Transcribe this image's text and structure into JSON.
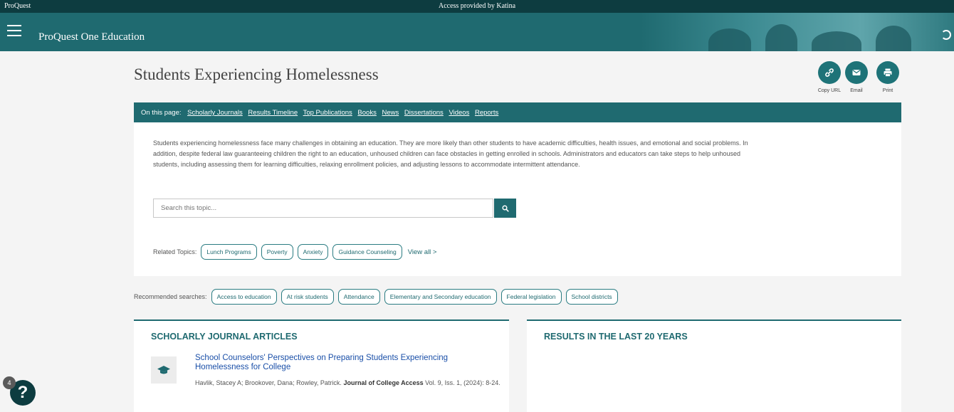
{
  "topbar": {
    "brand": "ProQuest",
    "access": "Access provided by Katina"
  },
  "header": {
    "title": "ProQuest One Education"
  },
  "page": {
    "title": "Students Experiencing Homelessness"
  },
  "actions": [
    {
      "label": "Copy URL",
      "icon": "link-icon"
    },
    {
      "label": "Email",
      "icon": "email-icon"
    },
    {
      "label": "Print",
      "icon": "print-icon"
    }
  ],
  "nav": {
    "on_this_page": "On this page:",
    "links": [
      "Scholarly Journals",
      "Results Timeline",
      "Top Publications",
      "Books",
      "News",
      "Dissertations",
      "Videos",
      "Reports"
    ]
  },
  "description": "Students experiencing homelessness face many challenges in obtaining an education. They are more likely than other students to have academic difficulties, health issues, and emotional and social problems. In addition, despite federal law guaranteeing children the right to an education, unhoused children can face obstacles in getting enrolled in schools. Administrators and educators can take steps to help unhoused students, including assessing them for learning difficulties, relaxing enrollment policies, and adjusting lessons to accommodate intermittent attendance.",
  "search": {
    "placeholder": "Search this topic..."
  },
  "related": {
    "label": "Related Topics:",
    "topics": [
      "Lunch Programs",
      "Poverty",
      "Anxiety",
      "Guidance Counseling"
    ],
    "view_all": "View all >"
  },
  "recommended": {
    "label": "Recommended searches:",
    "items": [
      "Access to education",
      "At risk students",
      "Attendance",
      "Elementary and Secondary education",
      "Federal legislation",
      "School districts"
    ]
  },
  "scholarly": {
    "heading": "SCHOLARLY JOURNAL ARTICLES",
    "article": {
      "title": "School Counselors' Perspectives on Preparing Students Experiencing Homelessness for College",
      "authors": "Havlik, Stacey A; Brookover, Dana; Rowley, Patrick.",
      "journal": "Journal of College Access",
      "details": "Vol. 9, Iss. 1, (2024): 8-24."
    }
  },
  "results": {
    "heading": "RESULTS IN THE LAST 20 YEARS"
  },
  "help": {
    "badge": "4",
    "glyph": "?"
  }
}
